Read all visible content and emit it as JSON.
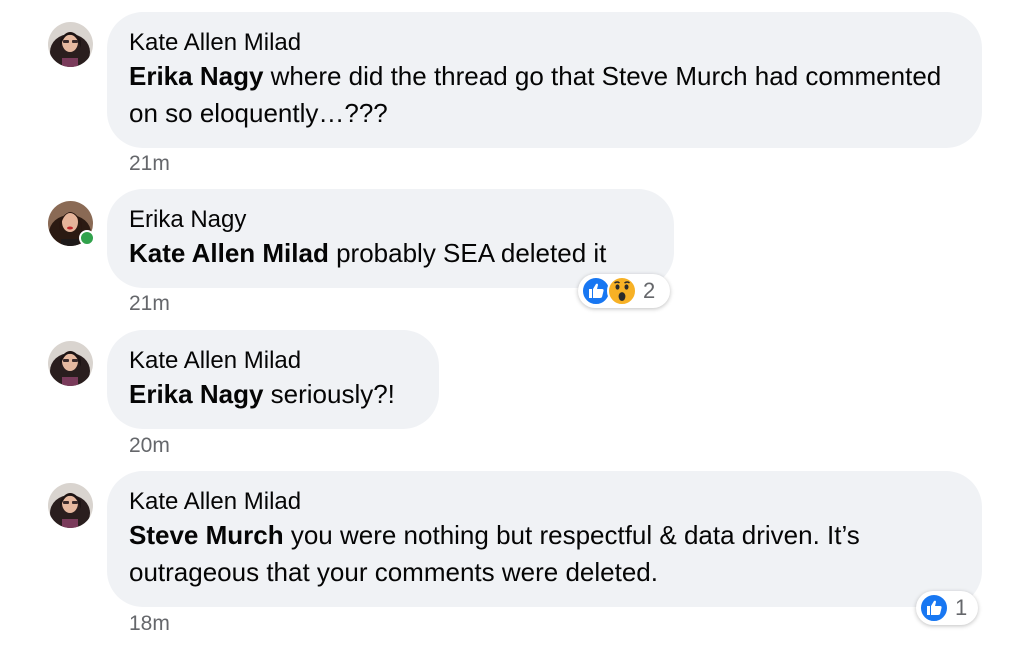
{
  "comments": [
    {
      "author": "Kate Allen Milad",
      "mention": "Erika Nagy",
      "text": " where did the thread go that Steve Murch had commented on so eloquently…???",
      "time": "21m"
    },
    {
      "author": "Erika Nagy",
      "mention": "Kate Allen Milad",
      "text": " probably SEA deleted it",
      "time": "21m",
      "reactions": {
        "icons": [
          "like-icon",
          "wow-icon"
        ],
        "count": "2"
      }
    },
    {
      "author": "Kate Allen Milad",
      "mention": "Erika Nagy",
      "text": " seriously?!",
      "time": "20m"
    },
    {
      "author": "Kate Allen Milad",
      "mention": "Steve Murch",
      "text": " you were nothing but respectful & data driven. It’s outrageous that your comments were deleted.",
      "time": "18m",
      "reactions": {
        "icons": [
          "like-icon"
        ],
        "count": "1"
      }
    }
  ],
  "colors": {
    "bubble": "#f0f2f5",
    "like": "#1877f2",
    "wow": "#f7b125",
    "online": "#31a24c",
    "meta": "#65676b"
  }
}
